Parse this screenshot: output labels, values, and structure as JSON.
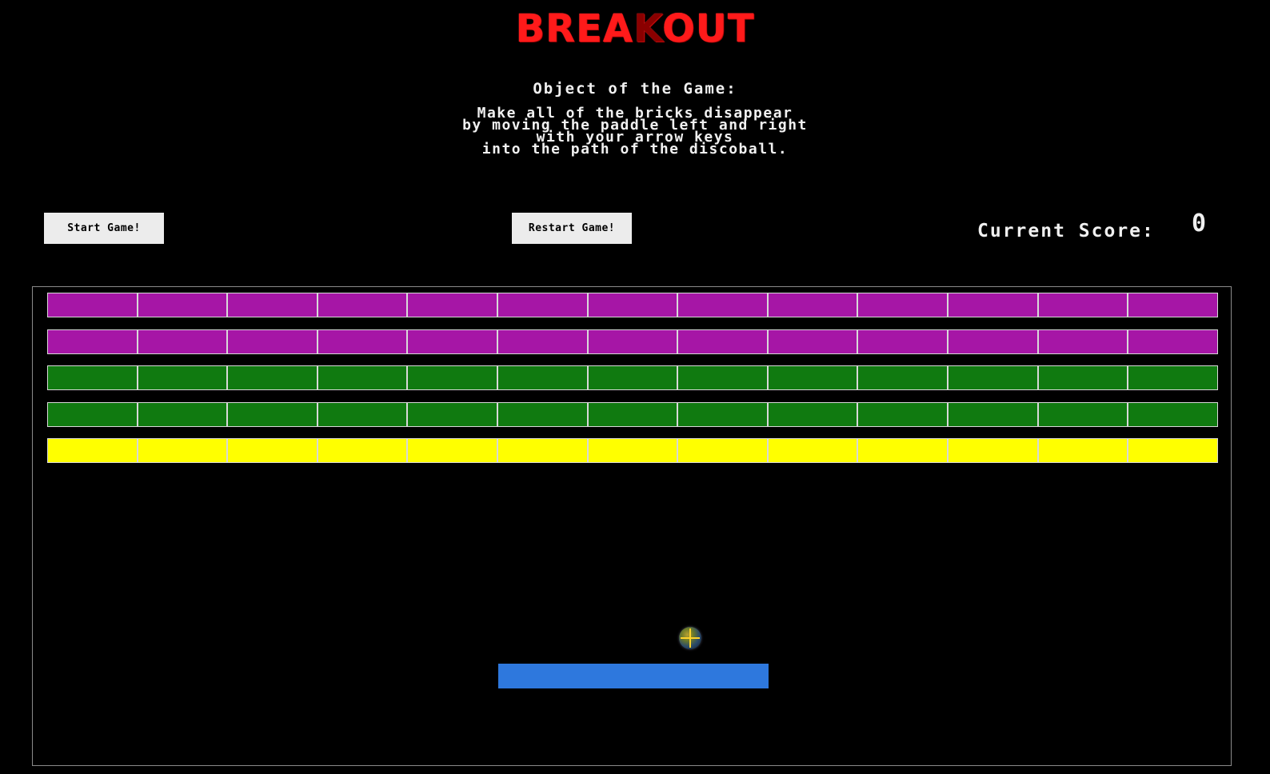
{
  "header": {
    "logo_main": "BREA",
    "logo_k": "K",
    "logo_end": "OUT"
  },
  "objective": {
    "heading": "Object of the Game:",
    "lines": [
      "Make all of the bricks disappear",
      "by moving the paddle left and right",
      "with your arrow keys",
      "into the path of the discoball."
    ]
  },
  "controls": {
    "start_label": "Start Game!",
    "restart_label": "Restart Game!"
  },
  "score": {
    "label": "Current Score:",
    "value": "0"
  },
  "board": {
    "columns": 13,
    "rows": [
      {
        "color": "#a616a6"
      },
      {
        "color": "#a616a6"
      },
      {
        "color": "#107a10"
      },
      {
        "color": "#107a10"
      },
      {
        "color": "#ffff00"
      }
    ],
    "paddle_color": "#2e78dd",
    "ball_icon": "discoball-icon"
  },
  "colors": {
    "logo": "#ff1a1a",
    "background": "#000000",
    "text": "#f0f0f0"
  }
}
